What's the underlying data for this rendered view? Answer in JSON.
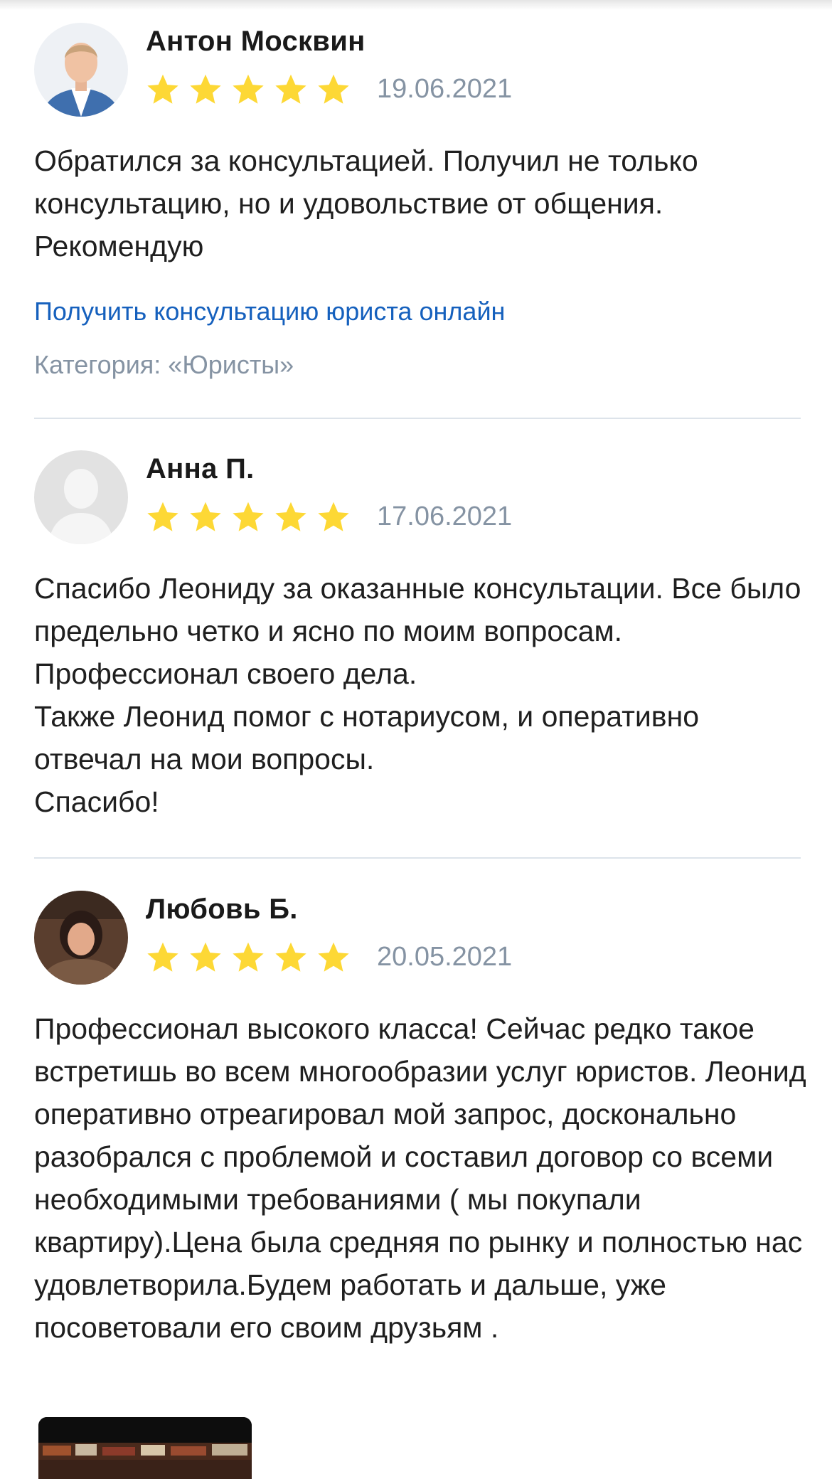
{
  "reviews": [
    {
      "author": "Антон Москвин",
      "date": "19.06.2021",
      "rating": 5,
      "text": "Обратился за консультацией. Получил не только консультацию, но и удовольствие от общения. Рекомендую",
      "link": "Получить консультацию юриста онлайн",
      "category": "Категория: «Юристы»"
    },
    {
      "author": "Анна П.",
      "date": "17.06.2021",
      "rating": 5,
      "text": "Спасибо Леониду за оказанные консультации. Все было предельно четко и ясно по моим вопросам.\nПрофессионал своего дела.\nТакже Леонид помог с нотариусом, и оперативно отвечал на мои вопросы.\nСпасибо!"
    },
    {
      "author": "Любовь Б.",
      "date": "20.05.2021",
      "rating": 5,
      "text": "Профессионал высокого класса! Сейчас редко такое встретишь во всем многообразии услуг юристов. Леонид оперативно отреагировал мой запрос, досконально разобрался с проблемой и составил договор со всеми необходимыми требованиями ( мы покупали квартиру).Цена была средняя по рынку и полностью нас удовлетворила.Будем работать и дальше, уже посоветовали его своим друзьям ."
    }
  ],
  "colors": {
    "star": "#fdd835",
    "link": "#1560bd",
    "muted": "#8593a3",
    "divider": "#dde3ea"
  }
}
